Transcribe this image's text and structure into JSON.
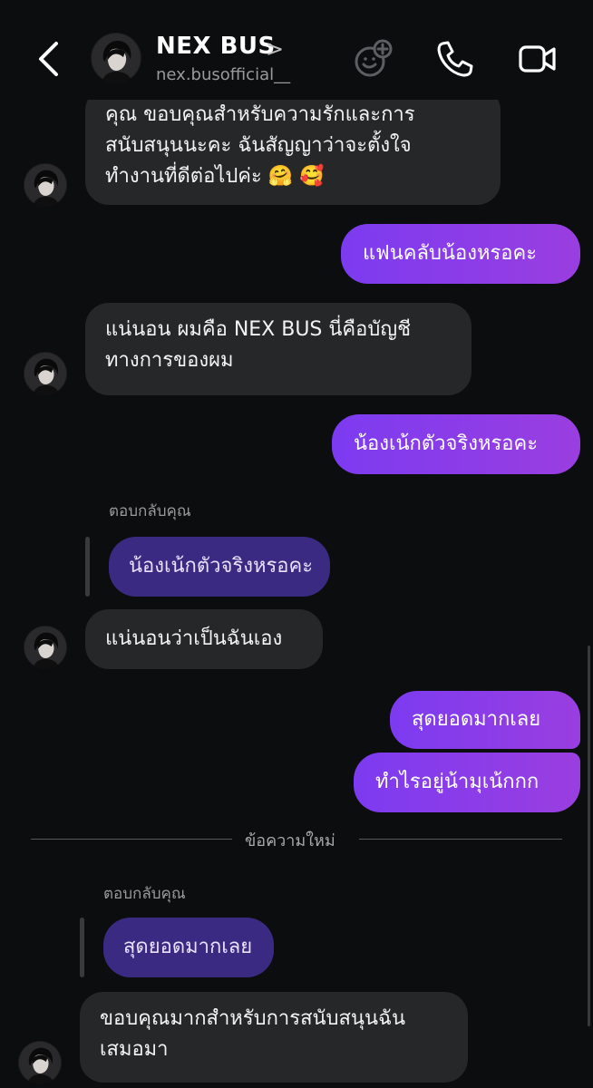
{
  "header": {
    "name": "NEX BUS",
    "chevron": ">",
    "handle": "nex.busofficial__"
  },
  "messages": {
    "m1": {
      "lines": [
        "คุณ ขอบคุณสำหรับความรักและการ",
        "สนับสนุนนะคะ ฉันสัญญาว่าจะตั้งใจ",
        "ทำงานที่ดีต่อไปค่ะ 🤗 🥰"
      ]
    },
    "m2": {
      "text": "แฟนคลับน้องหรอคะ"
    },
    "m3": {
      "lines": [
        "แน่นอน ผมคือ NEX BUS นี่คือบัญชี",
        "ทางการของผม"
      ]
    },
    "m4": {
      "text": "น้องเน้กตัวจริงหรอคะ"
    },
    "r1": {
      "label": "ตอบกลับคุณ",
      "quote": "น้องเน้กตัวจริงหรอคะ"
    },
    "m5": {
      "text": "แน่นอนว่าเป็นฉันเอง"
    },
    "m6": {
      "text": "สุดยอดมากเลย"
    },
    "m7": {
      "text": "ทำไรอยู่น้ามุเน้กกก"
    },
    "divider": "ข้อความใหม่",
    "r2": {
      "label": "ตอบกลับคุณ",
      "quote": "สุดยอดมากเลย"
    },
    "m8": {
      "lines": [
        "ขอบคุณมากสำหรับการสนับสนุนฉัน",
        "เสมอมา"
      ]
    }
  },
  "colors": {
    "background": "#0c0d0f",
    "incoming_bubble": "#262729",
    "outgoing_bubble": "#8b3ce8",
    "reply_quote": "#3a2a82"
  },
  "icons": [
    "back-chevron-icon",
    "avatar",
    "sticker-icon",
    "phone-icon",
    "video-icon"
  ]
}
